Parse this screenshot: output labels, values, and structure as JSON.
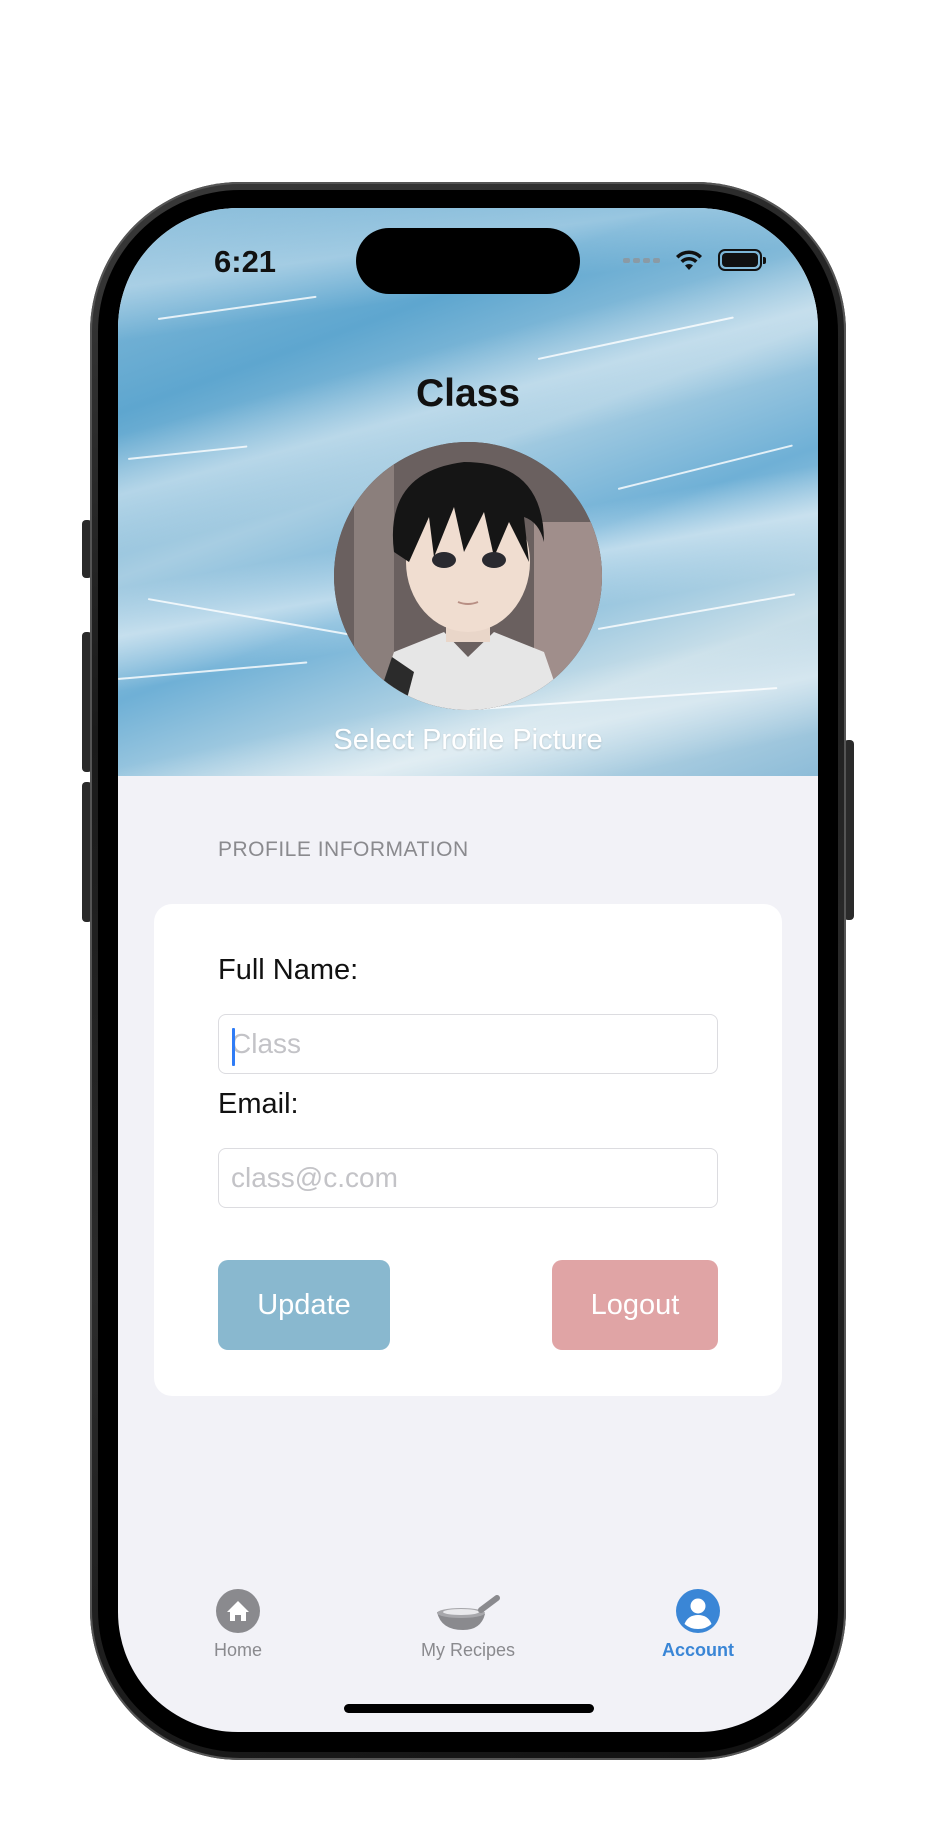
{
  "status_bar": {
    "time": "6:21"
  },
  "header": {
    "title": "Class",
    "select_picture_label": "Select Profile Picture"
  },
  "profile_section": {
    "header": "PROFILE INFORMATION",
    "full_name_label": "Full Name:",
    "full_name_placeholder": "Class",
    "email_label": "Email:",
    "email_placeholder": "class@c.com",
    "update_label": "Update",
    "logout_label": "Logout"
  },
  "tabbar": {
    "items": [
      {
        "label": "Home",
        "icon": "home-icon",
        "active": false
      },
      {
        "label": "My Recipes",
        "icon": "cooking-pan-icon",
        "active": false
      },
      {
        "label": "Account",
        "icon": "account-icon",
        "active": true
      }
    ]
  },
  "colors": {
    "accent": "#3a86d6",
    "update_button": "#89b8cf",
    "logout_button": "#e0a4a5",
    "background": "#f2f2f7"
  }
}
